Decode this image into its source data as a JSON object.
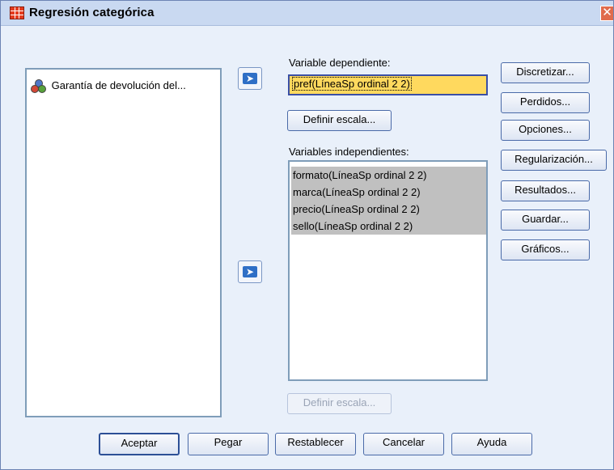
{
  "window": {
    "title": "Regresión categórica",
    "close_glyph": "✕"
  },
  "source_list": {
    "items": [
      {
        "label": "Garantía de devolución del...",
        "icon": "nominal-variable-icon"
      }
    ]
  },
  "dependent": {
    "label": "Variable dependiente:",
    "value": "pref(LíneaSp ordinal 2 2)",
    "define_scale_label": "Definir escala..."
  },
  "independent": {
    "label": "Variables independientes:",
    "items": [
      "formato(LíneaSp ordinal 2 2)",
      "marca(LíneaSp ordinal 2 2)",
      "precio(LíneaSp ordinal 2 2)",
      "sello(LíneaSp ordinal 2 2)"
    ],
    "define_scale_label": "Definir escala..."
  },
  "side_buttons": {
    "discretize": "Discretizar...",
    "missing": "Perdidos...",
    "options": "Opciones...",
    "regularization": "Regularización...",
    "output": "Resultados...",
    "save": "Guardar...",
    "plots": "Gráficos..."
  },
  "bottom_buttons": {
    "ok": "Aceptar",
    "paste": "Pegar",
    "reset": "Restablecer",
    "cancel": "Cancelar",
    "help": "Ayuda"
  },
  "colors": {
    "accent": "#2f6fc6",
    "selected_field": "#ffd95e",
    "selected_item": "#c0c0c0",
    "title_bar": "#c9d9f1"
  }
}
